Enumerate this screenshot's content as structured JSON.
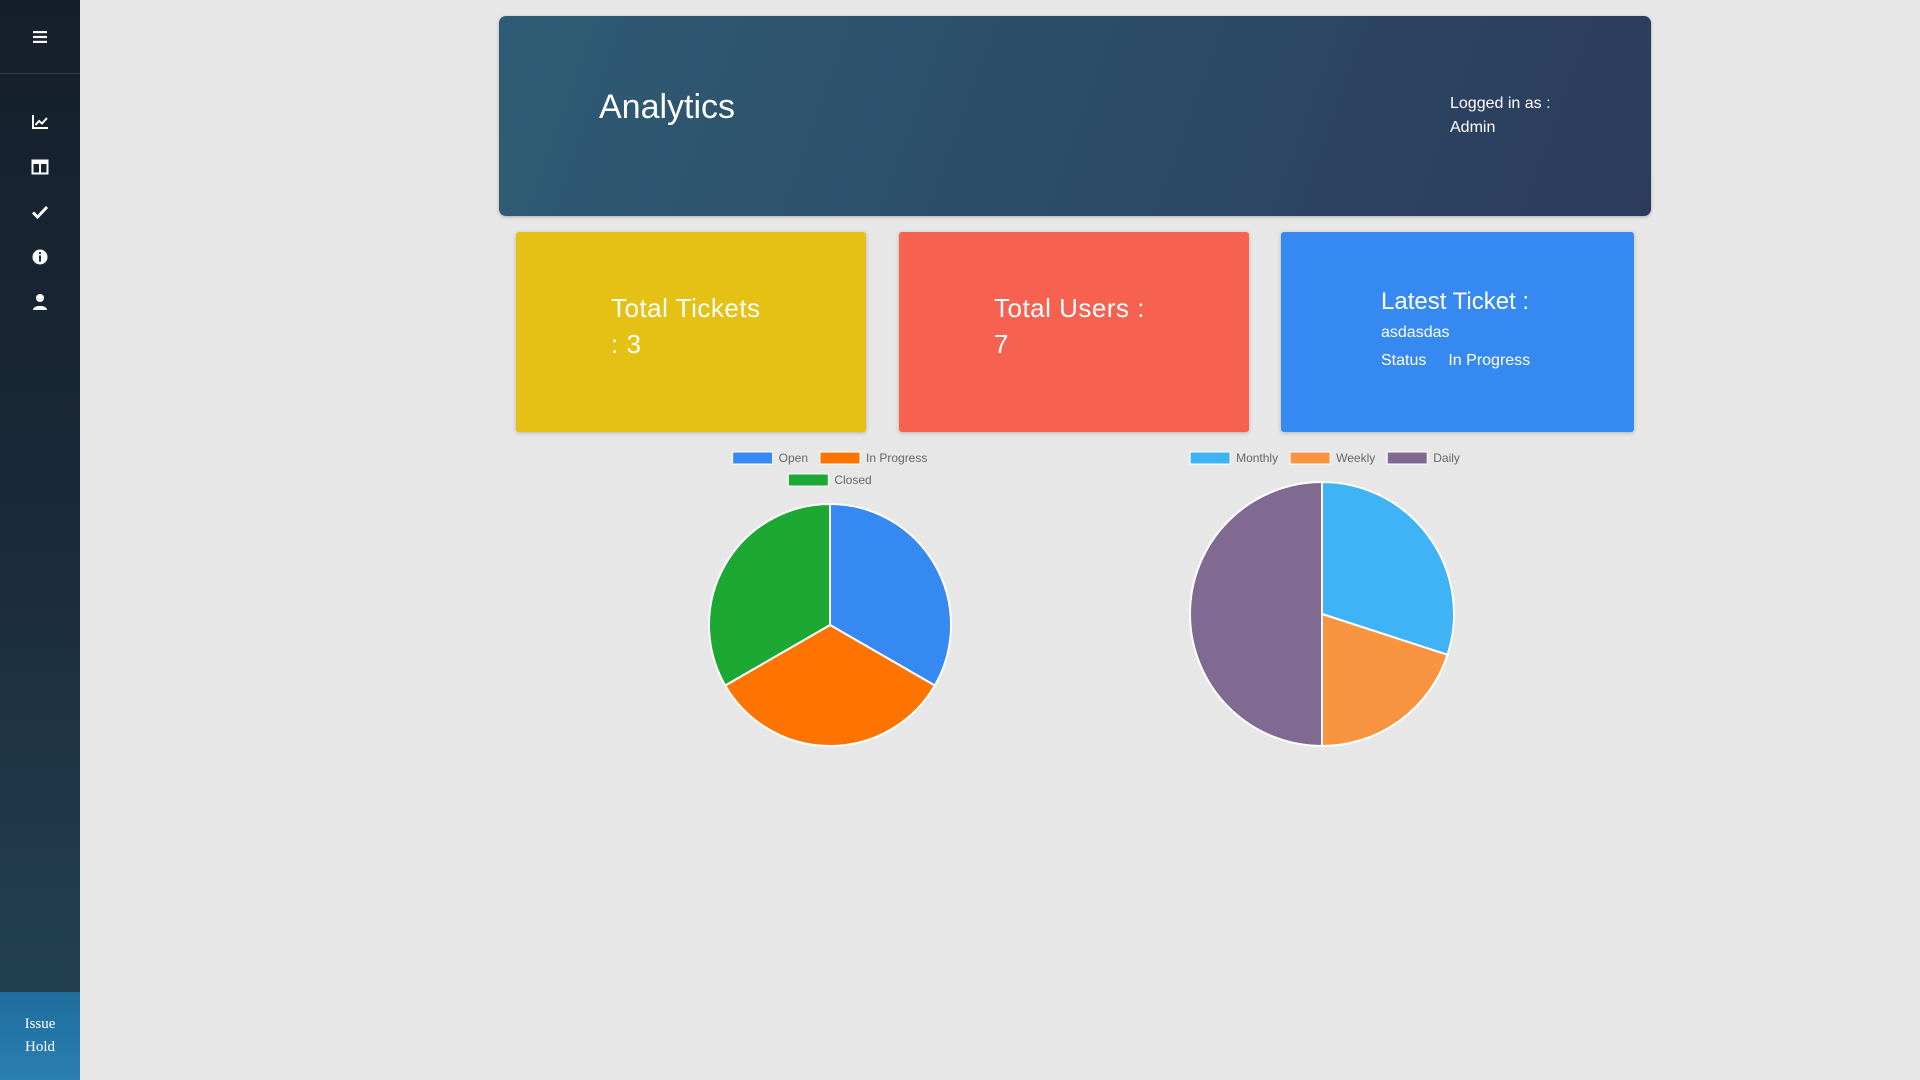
{
  "sidebar": {
    "menu_icon": "hamburger-icon",
    "items": [
      {
        "icon": "line-chart-icon"
      },
      {
        "icon": "table-icon"
      },
      {
        "icon": "check-icon"
      },
      {
        "icon": "info-icon"
      },
      {
        "icon": "user-icon"
      }
    ],
    "footer_line1": "Issue",
    "footer_line2": "Hold"
  },
  "header": {
    "title": "Analytics",
    "logged_in_label": "Logged in as :",
    "logged_in_user": "Admin"
  },
  "cards": {
    "tickets_line1": "Total Tickets",
    "tickets_line2": ": 3",
    "users_line1": "Total Users :",
    "users_line2": "7",
    "latest_title": "Latest Ticket :",
    "latest_name": "asdasdas",
    "latest_status_label": "Status",
    "latest_status_value": "In Progress"
  },
  "colors": {
    "yellow_card": "#e5c115",
    "red_card": "#f76150",
    "blue_card": "#3689f0"
  },
  "chart_data": [
    {
      "type": "pie",
      "categories": [
        "Open",
        "In Progress",
        "Closed"
      ],
      "values": [
        1,
        1,
        1
      ],
      "colors": [
        "#3689f0",
        "#ff7400",
        "#1ca832"
      ],
      "legend": "top"
    },
    {
      "type": "pie",
      "categories": [
        "Monthly",
        "Weekly",
        "Daily"
      ],
      "values": [
        30,
        20,
        50
      ],
      "colors": [
        "#3fb3f5",
        "#f99441",
        "#816a91"
      ],
      "legend": "top"
    }
  ]
}
